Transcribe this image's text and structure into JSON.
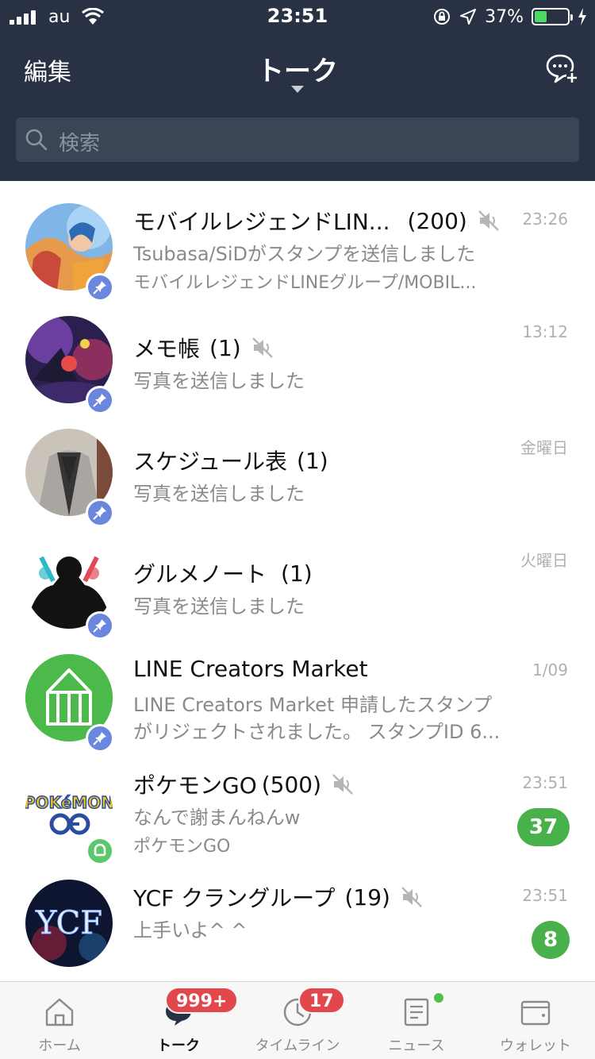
{
  "status_bar": {
    "carrier": "au",
    "time": "23:51",
    "battery": "37%",
    "battery_level": 0.37
  },
  "header": {
    "edit_label": "編集",
    "title": "トーク",
    "search_placeholder": "検索"
  },
  "chats": [
    {
      "name": "モバイルレジェンドLIN...",
      "count": "(200)",
      "muted": true,
      "pinned": true,
      "preview1": "Tsubasa/SiDがスタンプを送信しました",
      "preview2": "モバイルレジェンドLINEグループ/MOBIL...",
      "time": "23:26",
      "unread": ""
    },
    {
      "name": "メモ帳",
      "count": "(1)",
      "muted": true,
      "pinned": true,
      "preview1": "写真を送信しました",
      "preview2": "",
      "time": "13:12",
      "unread": ""
    },
    {
      "name": "スケジュール表",
      "count": "(1)",
      "muted": false,
      "pinned": true,
      "preview1": "写真を送信しました",
      "preview2": "",
      "time": "金曜日",
      "unread": ""
    },
    {
      "name": "グルメノート",
      "count": "(1)",
      "muted": false,
      "pinned": true,
      "preview1": "写真を送信しました",
      "preview2": "",
      "time": "火曜日",
      "unread": ""
    },
    {
      "name": "LINE Creators Market",
      "count": "",
      "muted": false,
      "pinned": true,
      "preview1": "LINE Creators Market 申請したスタンプ",
      "preview2": "がリジェクトされました。 スタンプID 6...",
      "time": "1/09",
      "unread": ""
    },
    {
      "name": "ポケモンGO",
      "count": "(500)",
      "muted": true,
      "pinned": false,
      "preview1": "なんで謝まんねんw",
      "preview2": "ポケモンGO",
      "time": "23:51",
      "unread": "37",
      "avatar_text": "POKéMON"
    },
    {
      "name": "YCF クラングループ",
      "count": "(19)",
      "muted": true,
      "pinned": false,
      "preview1": "上手いよ^ ^",
      "preview2": "",
      "time": "23:51",
      "unread": "8",
      "avatar_text": "YCF"
    }
  ],
  "tabs": [
    {
      "label": "ホーム",
      "badge": ""
    },
    {
      "label": "トーク",
      "badge": "999+"
    },
    {
      "label": "タイムライン",
      "badge": "17"
    },
    {
      "label": "ニュース",
      "badge": ""
    },
    {
      "label": "ウォレット",
      "badge": ""
    }
  ],
  "colors": {
    "header_bg": "#283244",
    "unread_green": "#48b14b",
    "badge_red": "#e2474b",
    "pin_blue": "#6a86dd"
  },
  "icons": [
    "signal-icon",
    "wifi-icon",
    "lock-rotation-icon",
    "location-icon",
    "battery-icon",
    "charging-icon",
    "new-chat-icon",
    "search-icon",
    "pin-icon",
    "mute-icon",
    "home-icon",
    "talk-icon",
    "timeline-icon",
    "news-icon",
    "wallet-icon"
  ]
}
